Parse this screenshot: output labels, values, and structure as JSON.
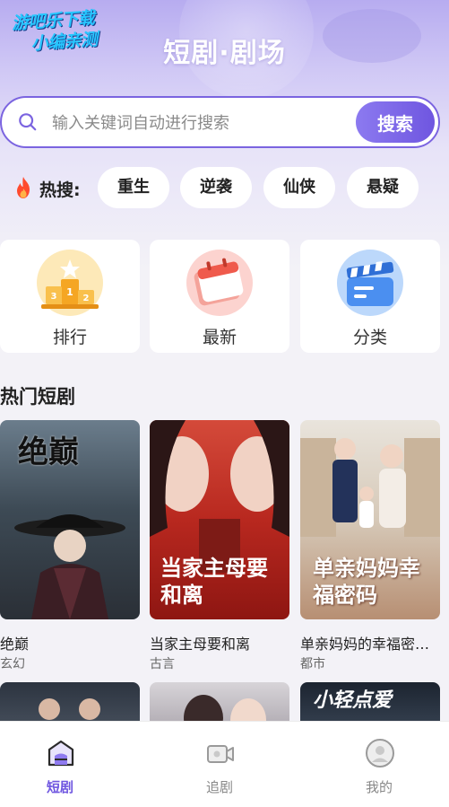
{
  "watermark": {
    "line1": "游吧乐下载",
    "line2": "小编亲测"
  },
  "header": {
    "title": "短剧·剧场"
  },
  "search": {
    "placeholder": "输入关键词自动进行搜索",
    "value": "",
    "button_label": "搜索"
  },
  "hot_search": {
    "label": "热搜:",
    "tags": [
      "重生",
      "逆袭",
      "仙侠",
      "悬疑"
    ]
  },
  "categories": [
    {
      "label": "排行",
      "icon": "ranking-podium-icon"
    },
    {
      "label": "最新",
      "icon": "calendar-icon"
    },
    {
      "label": "分类",
      "icon": "clapperboard-icon"
    }
  ],
  "section": {
    "title": "热门短剧"
  },
  "dramas": [
    {
      "title": "绝巅",
      "genre": "玄幻",
      "poster_text": "绝巅"
    },
    {
      "title": "当家主母要和离",
      "genre": "古言",
      "poster_text": "当家主母要和离"
    },
    {
      "title": "单亲妈妈的幸福密…",
      "genre": "都市",
      "poster_text": "单亲妈妈幸福密码"
    }
  ],
  "more_dramas": [
    {
      "poster_text": ""
    },
    {
      "poster_text": ""
    },
    {
      "poster_text": "小轻点爱"
    }
  ],
  "tabbar": {
    "tabs": [
      {
        "label": "短剧",
        "icon": "home-theater-icon",
        "active": true
      },
      {
        "label": "追剧",
        "icon": "video-camera-icon",
        "active": false
      },
      {
        "label": "我的",
        "icon": "profile-avatar-icon",
        "active": false
      }
    ]
  },
  "colors": {
    "accent": "#6f56e0",
    "background": "#f3f2f7"
  }
}
